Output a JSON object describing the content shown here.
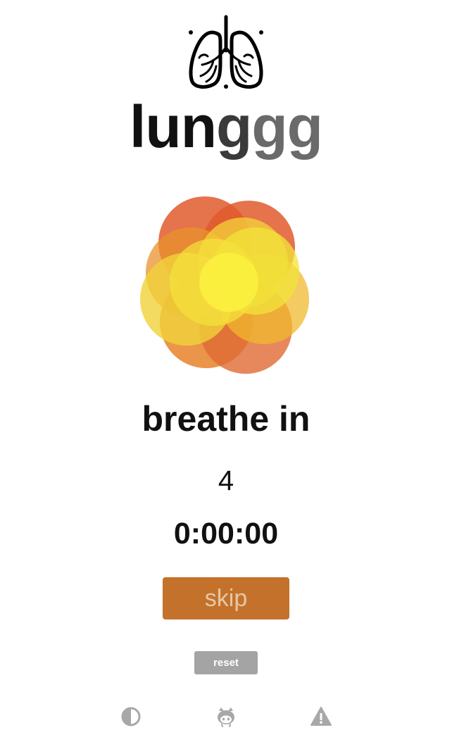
{
  "app": {
    "logo_icon": "lungs-icon",
    "title_parts": [
      "lun",
      "g",
      "gg"
    ],
    "title_colors": [
      "#111111",
      "#3a3a3a",
      "#6a6a6a"
    ]
  },
  "breathing": {
    "phase_label": "breathe in",
    "count": "4",
    "elapsed": "0:00:00",
    "bloom_colors": [
      "#e05a2b",
      "#e8832b",
      "#f0b82e",
      "#f2e43a",
      "#fbf13f"
    ]
  },
  "controls": {
    "skip_label": "skip",
    "reset_label": "reset",
    "skip_color": "#c4722b",
    "reset_color": "#a4a4a4"
  },
  "footer": {
    "icons": [
      "contrast-icon",
      "github-icon",
      "warning-icon"
    ]
  }
}
